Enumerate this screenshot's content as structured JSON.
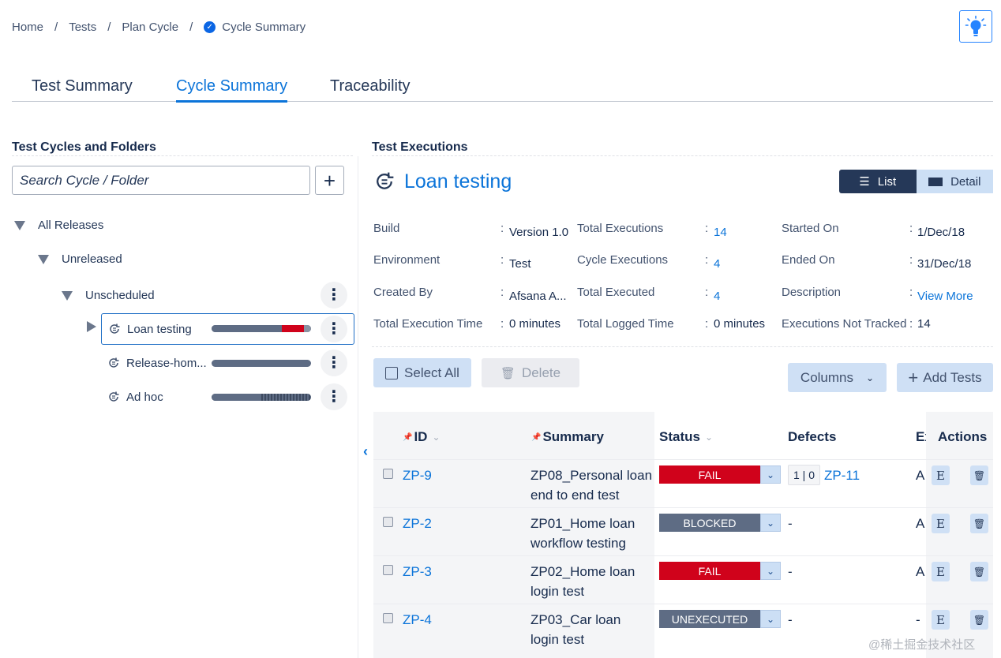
{
  "breadcrumb": {
    "items": [
      "Home",
      "Tests",
      "Plan Cycle",
      "Cycle Summary"
    ],
    "separator": "/"
  },
  "tabs": [
    "Test Summary",
    "Cycle Summary",
    "Traceability"
  ],
  "left_panel": {
    "title": "Test Cycles and Folders",
    "search_placeholder": "Search Cycle / Folder",
    "add_label": "+",
    "tree": {
      "all_releases": "All Releases",
      "unreleased": "Unreleased",
      "unscheduled": "Unscheduled",
      "cycles": [
        {
          "name": "Loan testing",
          "selected": true,
          "progress": {
            "unexecuted": 0.71,
            "fail": 0.22,
            "blocked": 0.07
          }
        },
        {
          "name": "Release-hom...",
          "selected": false,
          "progress": {
            "unexecuted": 1.0,
            "fail": 0,
            "blocked": 0
          }
        },
        {
          "name": "Ad hoc",
          "selected": false,
          "progress": {
            "unexecuted": 0.5,
            "fail": 0,
            "blocked": 0.5
          }
        }
      ]
    }
  },
  "right_panel": {
    "title": "Test Executions",
    "cycle_name": "Loan testing",
    "view_toggle": {
      "list": "List",
      "detail": "Detail",
      "active": "List"
    },
    "info": {
      "col1": [
        {
          "label": "Build",
          "value": "Version 1.0"
        },
        {
          "label": "Environment",
          "value": "Test"
        },
        {
          "label": "Created By",
          "value": "Afsana A..."
        },
        {
          "label": "Total Execution Time",
          "value": "0 minutes"
        }
      ],
      "col2": [
        {
          "label": "Total Executions",
          "value": "14"
        },
        {
          "label": "Cycle Executions",
          "value": "4"
        },
        {
          "label": "Total Executed",
          "value": "4"
        },
        {
          "label": "Total Logged Time",
          "value": "0 minutes"
        }
      ],
      "col3": [
        {
          "label": "Started On",
          "value": "1/Dec/18"
        },
        {
          "label": "Ended On",
          "value": "31/Dec/18"
        },
        {
          "label": "Description",
          "value": "View More"
        },
        {
          "label": "Executions Not Tracked",
          "value": "14"
        }
      ],
      "colon": ":"
    },
    "toolbar": {
      "select_all": "Select All",
      "delete": "Delete",
      "columns": "Columns",
      "add_tests": "Add Tests"
    },
    "table": {
      "headers": {
        "id": "ID",
        "summary": "Summary",
        "status": "Status",
        "defects": "Defects",
        "ex": "Ex",
        "actions": "Actions"
      },
      "rows": [
        {
          "id": "ZP-9",
          "summary_1": "ZP08_Personal loan",
          "summary_2": "end to end test",
          "status": "FAIL",
          "status_color": "#d0021b",
          "defect_count": "1 | 0",
          "defect_link": "ZP-11",
          "ex": "A",
          "action_e": "E"
        },
        {
          "id": "ZP-2",
          "summary_1": "ZP01_Home loan",
          "summary_2": "workflow testing",
          "status": "BLOCKED",
          "status_color": "#5e6c84",
          "defect_count": "",
          "defect_link": "-",
          "ex": "A",
          "action_e": "E"
        },
        {
          "id": "ZP-3",
          "summary_1": "ZP02_Home loan",
          "summary_2": "login test",
          "status": "FAIL",
          "status_color": "#d0021b",
          "defect_count": "",
          "defect_link": "-",
          "ex": "A",
          "action_e": "E"
        },
        {
          "id": "ZP-4",
          "summary_1": "ZP03_Car loan",
          "summary_2": "login test",
          "status": "UNEXECUTED",
          "status_color": "#5e6c84",
          "defect_count": "",
          "defect_link": "-",
          "ex": "-",
          "action_e": "E"
        }
      ]
    }
  },
  "watermark": "@稀土掘金技术社区",
  "colors": {
    "accent": "#0b74d9",
    "fail": "#d0021b",
    "unexecuted": "#5e6c84",
    "dark": "#253858"
  }
}
